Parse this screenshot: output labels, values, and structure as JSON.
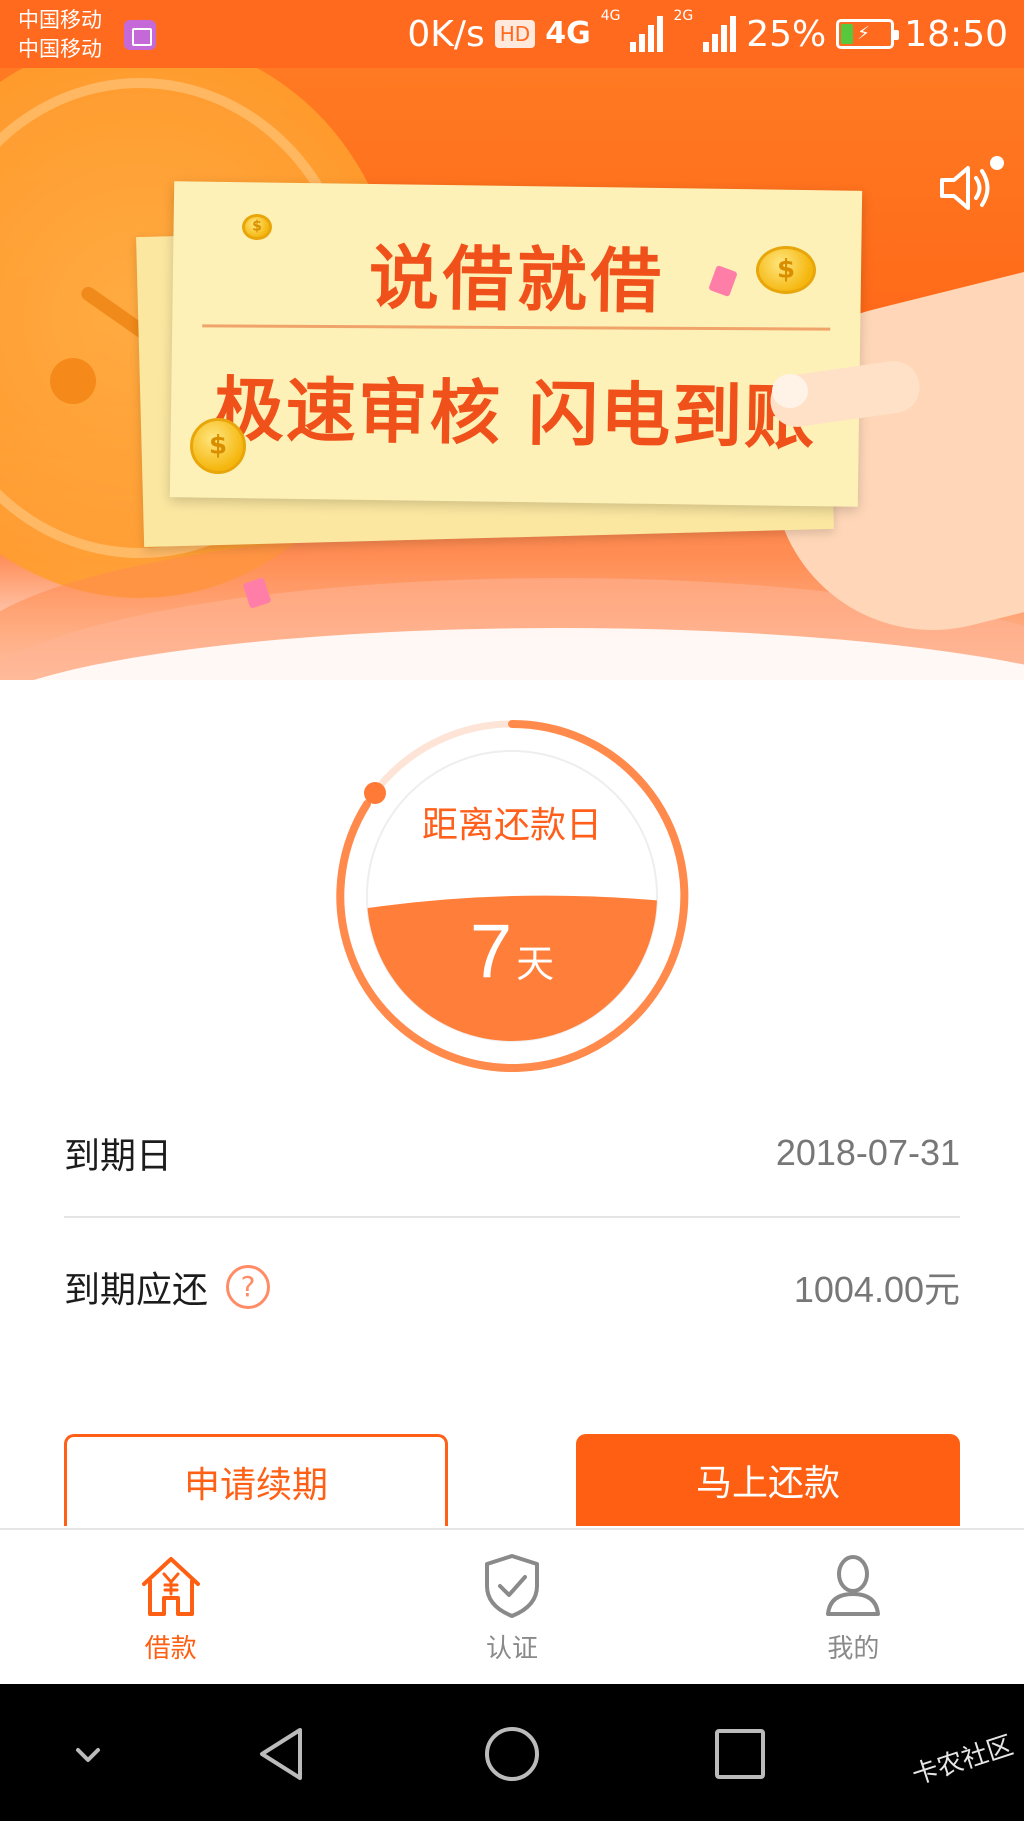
{
  "status_bar": {
    "carrier_1": "中国移动",
    "carrier_2": "中国移动",
    "speed": "0K/s",
    "hd": "HD",
    "network_1": "4G",
    "network_1_small": "4G",
    "network_2": "2G",
    "battery": "25%",
    "battery_level": 0.25,
    "time": "18:50"
  },
  "banner": {
    "slogan_line1": "说借就借",
    "slogan_line2": "极速审核 闪电到账",
    "slides_total": 2,
    "active_slide": 1
  },
  "countdown": {
    "label": "距离还款日",
    "days": "7",
    "unit": "天"
  },
  "repayment": {
    "due_date_label": "到期日",
    "due_date_value": "2018-07-31",
    "due_amount_label": "到期应还",
    "due_amount_value": "1004.00元",
    "help_glyph": "?"
  },
  "actions": {
    "renew_label": "申请续期",
    "repay_label": "马上还款"
  },
  "tabs": [
    {
      "label": "借款",
      "icon": "house-yuan-icon",
      "active": true
    },
    {
      "label": "认证",
      "icon": "shield-check-icon",
      "active": false
    },
    {
      "label": "我的",
      "icon": "person-icon",
      "active": false
    }
  ],
  "watermark": "卡农社区",
  "colors": {
    "accent": "#ff5f12",
    "banner": "#ff6a1f",
    "muted_text": "#8a8a8a"
  }
}
